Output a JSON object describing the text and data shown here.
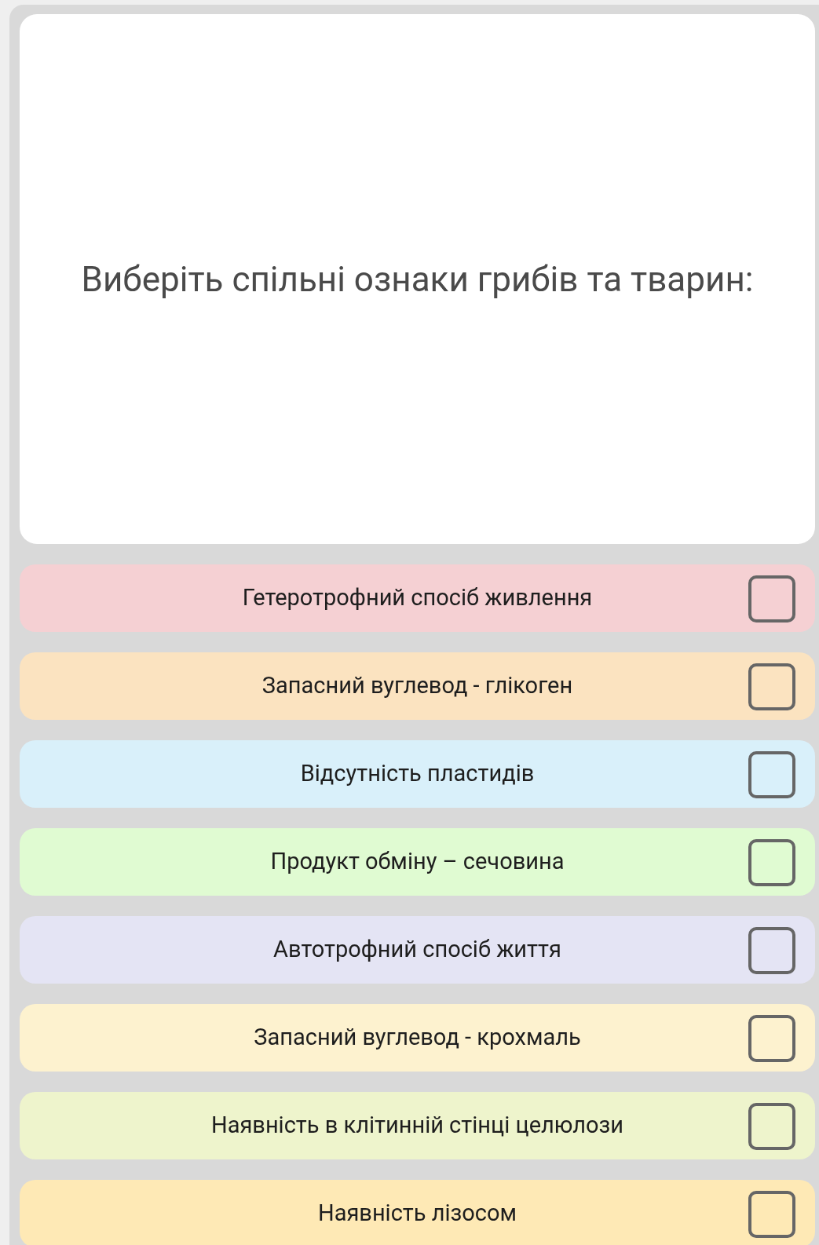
{
  "question": "Виберіть спільні ознаки грибів та тварин:",
  "options": [
    {
      "label": "Гетеротрофний спосіб живлення",
      "color": "#f5d0d3",
      "checked": false
    },
    {
      "label": "Запасний вуглевод - глікоген",
      "color": "#fbe3c0",
      "checked": false
    },
    {
      "label": "Відсутність пластидів",
      "color": "#d9f0fa",
      "checked": false
    },
    {
      "label": "Продукт обміну – сечовина",
      "color": "#e0fbd2",
      "checked": false
    },
    {
      "label": "Автотрофний спосіб життя",
      "color": "#e4e4f4",
      "checked": false
    },
    {
      "label": "Запасний вуглевод - крохмаль",
      "color": "#fdf2cf",
      "checked": false
    },
    {
      "label": "Наявність в клітинній стінці целюлози",
      "color": "#eef4cc",
      "checked": false
    },
    {
      "label": "Наявність лізосом",
      "color": "#fee9b5",
      "checked": false
    }
  ]
}
